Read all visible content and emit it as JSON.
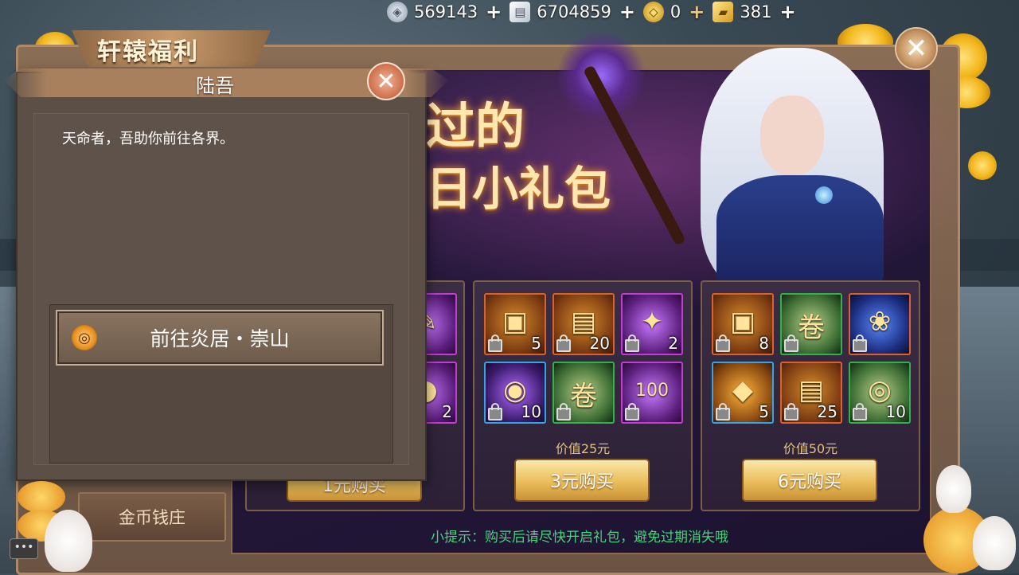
{
  "currency": [
    {
      "icon": "silver-coin-icon",
      "value": "569143",
      "add": "+"
    },
    {
      "icon": "bank-note-icon",
      "value": "6704859",
      "add": "+"
    },
    {
      "icon": "gold-ingot-icon",
      "value": "0",
      "add": "+"
    },
    {
      "icon": "gold-ticket-icon",
      "value": "381",
      "add": "+"
    }
  ],
  "panel": {
    "title": "轩辕福利",
    "close_glyph": "✕"
  },
  "banner": {
    "line1": "过的",
    "line2": "日小礼包"
  },
  "nav": {
    "item_gold_bank": "金币钱庄"
  },
  "cards": [
    {
      "items": [
        {
          "glyph": "✎",
          "count": "",
          "border": "b-purple"
        },
        {
          "glyph": "●",
          "count": "2",
          "border": "b-purple"
        }
      ],
      "price": "",
      "buy": "1元购买"
    },
    {
      "items": [
        {
          "glyph": "▣",
          "count": "5",
          "border": "b-orange"
        },
        {
          "glyph": "▤",
          "count": "20",
          "border": "b-orange"
        },
        {
          "glyph": "✦",
          "count": "2",
          "border": "b-purple"
        },
        {
          "glyph": "◉",
          "count": "10",
          "border": "b-blue"
        },
        {
          "glyph": "卷",
          "count": "",
          "border": "b-green"
        },
        {
          "glyph": "100",
          "count": "",
          "border": "b-purple"
        }
      ],
      "price": "价值25元",
      "buy": "3元购买"
    },
    {
      "items": [
        {
          "glyph": "▣",
          "count": "8",
          "border": "b-orange"
        },
        {
          "glyph": "卷",
          "count": "",
          "border": "b-green"
        },
        {
          "glyph": "❀",
          "count": "",
          "border": "b-orange"
        },
        {
          "glyph": "◆",
          "count": "5",
          "border": "b-blue"
        },
        {
          "glyph": "▤",
          "count": "25",
          "border": "b-orange"
        },
        {
          "glyph": "◎",
          "count": "10",
          "border": "b-green"
        }
      ],
      "price": "价值50元",
      "buy": "6元购买"
    }
  ],
  "tip": "小提示：购买后请尽快开启礼包，避免过期消失哦",
  "npc": {
    "name": "陆吾",
    "close_glyph": "✕",
    "text": "天命者，吾助你前往各界。",
    "option_label": "前往炎居・崇山",
    "option_icon_glyph": "◎"
  },
  "chat_glyph": "•••"
}
